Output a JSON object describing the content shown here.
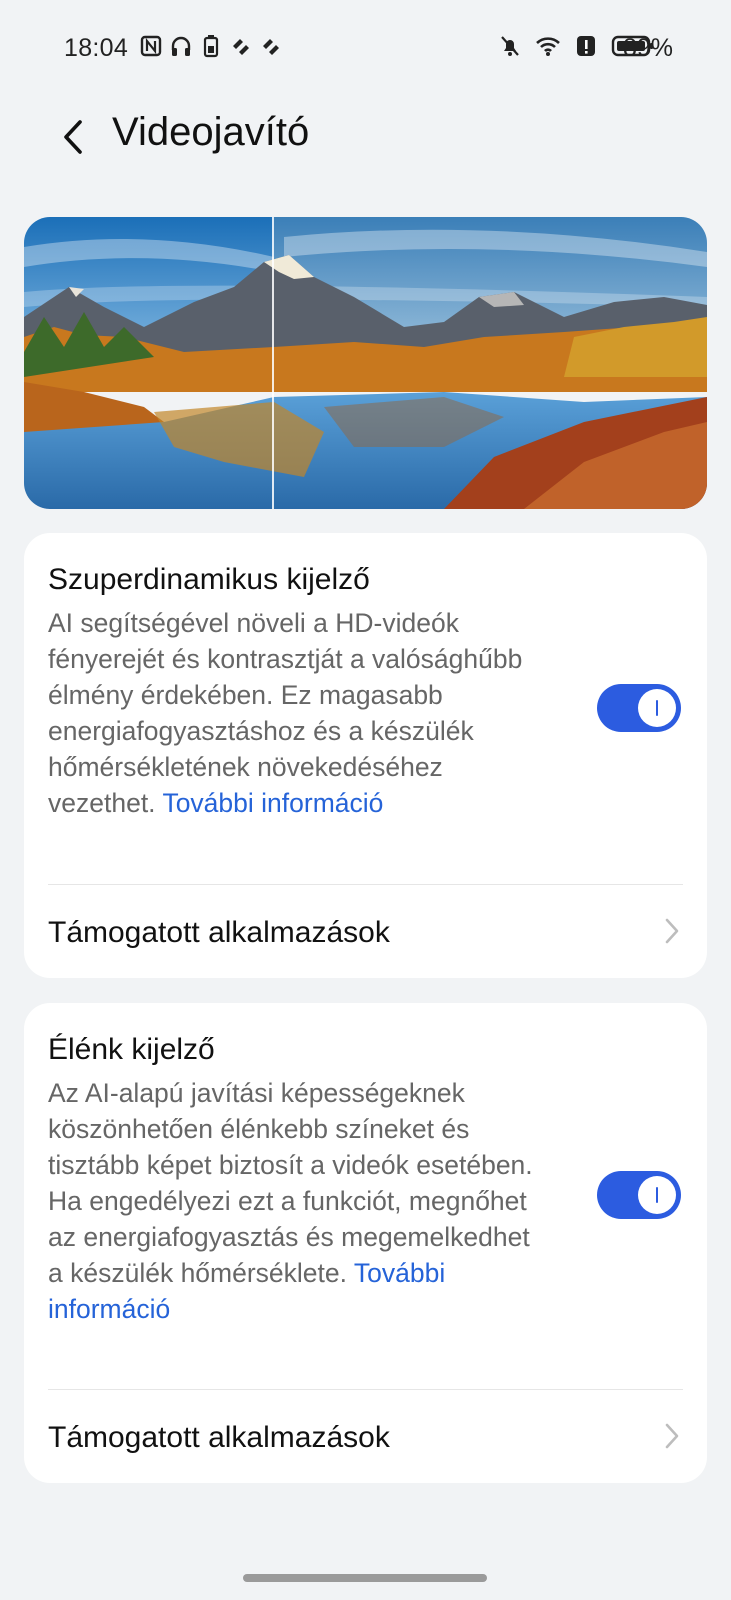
{
  "status_bar": {
    "time": "18:04",
    "battery_percent": "89%",
    "left_icons": [
      "nfc-icon",
      "headphones-icon",
      "battery-saver-icon",
      "diamond-icon",
      "diamond-icon"
    ],
    "right_icons": [
      "bell-off-icon",
      "wifi-icon",
      "alert-icon",
      "battery-icon"
    ]
  },
  "header": {
    "title": "Videojavító",
    "back_icon": "chevron-left-icon"
  },
  "sections": [
    {
      "title": "Szuperdinamikus kijelző",
      "description": "AI segítségével növeli a HD-videók fényerejét és kontrasztját a valósághűbb élmény érdekében. Ez magasabb energiafogyasztáshoz és a készülék hőmérsékletének növekedéséhez vezethet.",
      "more_link": "További információ",
      "toggle_on": true,
      "row_label": "Támogatott alkalmazások"
    },
    {
      "title": "Élénk kijelző",
      "description": "Az AI-alapú javítási képességeknek köszönhetően élénkebb színeket és tisztább képet biztosít a videók esetében. Ha engedélyezi ezt a funkciót, megnőhet az energiafogyasztás és megemelkedhet a készülék hőmérséklete.",
      "more_link": "További információ",
      "toggle_on": true,
      "row_label": "Támogatott alkalmazások"
    }
  ],
  "colors": {
    "accent": "#2c5ce0",
    "link": "#2563d8",
    "background": "#f1f3f5"
  }
}
